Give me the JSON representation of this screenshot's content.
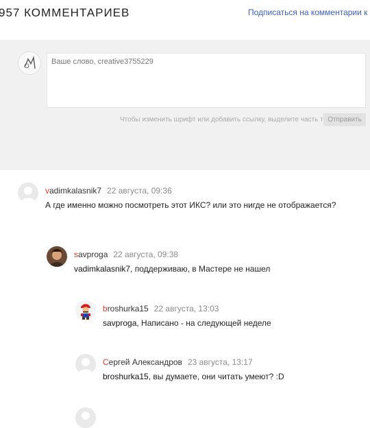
{
  "header": {
    "count": "957 КОММЕНТАРИЕВ",
    "subscribe": "Подписаться на комментарии к по"
  },
  "composer": {
    "placeholder": "Ваше слово, creative3755229",
    "hint": "Чтобы изменить шрифт или добавить ссылку, выделите часть текста.",
    "send_label": "Отправить"
  },
  "comments": [
    {
      "author_first": "v",
      "author_rest": "adimkalasnik7",
      "date": "22 августа, 09:36",
      "reply_to": "",
      "text": "А где именно можно посмотреть этот ИКС? или это нигде не отображается?"
    },
    {
      "author_first": "s",
      "author_rest": "avproga",
      "date": "22 августа, 09:38",
      "reply_to": "vadimkalasnik7,",
      "text": " поддерживаю, в Мастере не нашел"
    },
    {
      "author_first": "b",
      "author_rest": "roshurka15",
      "date": "22 августа, 13:03",
      "reply_to": "savproga,",
      "text": "  Написано - на следующей неделе"
    },
    {
      "author_first": "С",
      "author_rest": "ергей Александров",
      "date": "23 августа, 13:17",
      "reply_to": "broshurka15,",
      "text": " вы думаете, они читать умеют? :D"
    }
  ]
}
